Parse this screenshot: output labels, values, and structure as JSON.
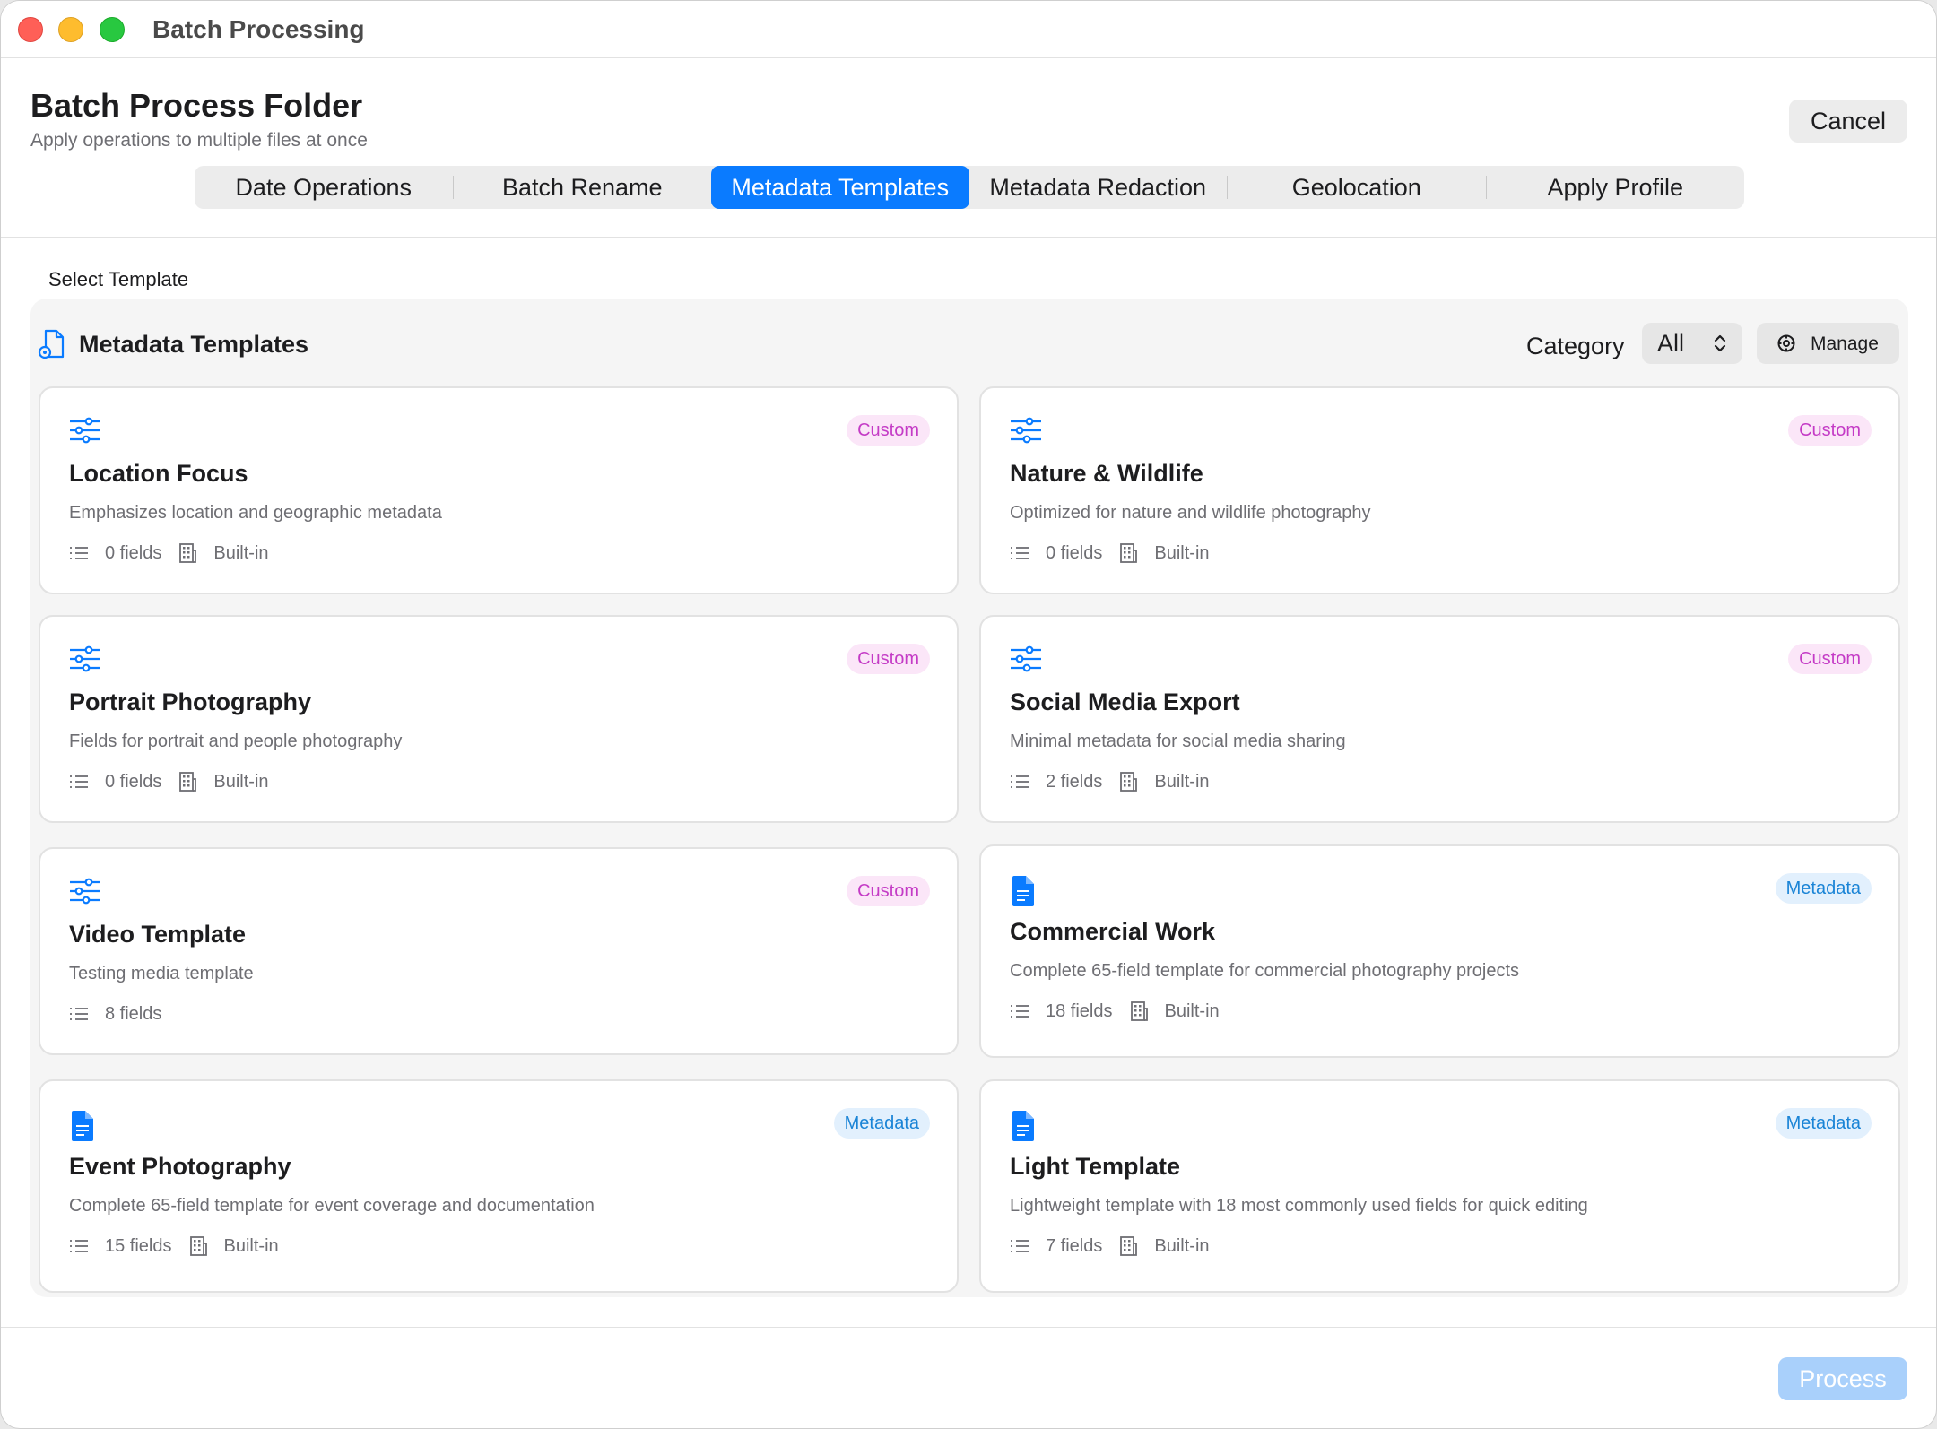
{
  "window": {
    "title": "Batch Processing"
  },
  "header": {
    "title": "Batch Process Folder",
    "subtitle": "Apply operations to multiple files at once",
    "cancel_label": "Cancel"
  },
  "tabs": [
    {
      "label": "Date Operations",
      "active": false
    },
    {
      "label": "Batch Rename",
      "active": false
    },
    {
      "label": "Metadata Templates",
      "active": true
    },
    {
      "label": "Metadata Redaction",
      "active": false
    },
    {
      "label": "Geolocation",
      "active": false
    },
    {
      "label": "Apply Profile",
      "active": false
    }
  ],
  "content": {
    "section_label": "Select Template",
    "panel_title": "Metadata Templates",
    "category_label": "Category",
    "category_value": "All",
    "manage_label": "Manage"
  },
  "templates": [
    {
      "title": "Location Focus",
      "description": "Emphasizes location and geographic metadata",
      "fields": "0 fields",
      "source": "Built-in",
      "badge": "Custom",
      "icon": "sliders-icon"
    },
    {
      "title": "Nature & Wildlife",
      "description": "Optimized for nature and wildlife photography",
      "fields": "0 fields",
      "source": "Built-in",
      "badge": "Custom",
      "icon": "sliders-icon"
    },
    {
      "title": "Portrait Photography",
      "description": "Fields for portrait and people photography",
      "fields": "0 fields",
      "source": "Built-in",
      "badge": "Custom",
      "icon": "sliders-icon"
    },
    {
      "title": "Social Media Export",
      "description": "Minimal metadata for social media sharing",
      "fields": "2 fields",
      "source": "Built-in",
      "badge": "Custom",
      "icon": "sliders-icon"
    },
    {
      "title": "Video Template",
      "description": "Testing media template",
      "fields": "8 fields",
      "source": "",
      "badge": "Custom",
      "icon": "sliders-icon"
    },
    {
      "title": "Commercial Work",
      "description": "Complete 65-field template for commercial photography projects",
      "fields": "18 fields",
      "source": "Built-in",
      "badge": "Metadata",
      "icon": "document-icon"
    },
    {
      "title": "Event Photography",
      "description": "Complete 65-field template for event coverage and documentation",
      "fields": "15 fields",
      "source": "Built-in",
      "badge": "Metadata",
      "icon": "document-icon"
    },
    {
      "title": "Light Template",
      "description": "Lightweight template with 18 most commonly used fields for quick editing",
      "fields": "7 fields",
      "source": "Built-in",
      "badge": "Metadata",
      "icon": "document-icon"
    }
  ],
  "footer": {
    "process_label": "Process"
  },
  "colors": {
    "accent": "#0a7bff",
    "custom_badge": "#c43bc6",
    "metadata_badge": "#1a84d6",
    "process_disabled": "#a9d0fb"
  }
}
